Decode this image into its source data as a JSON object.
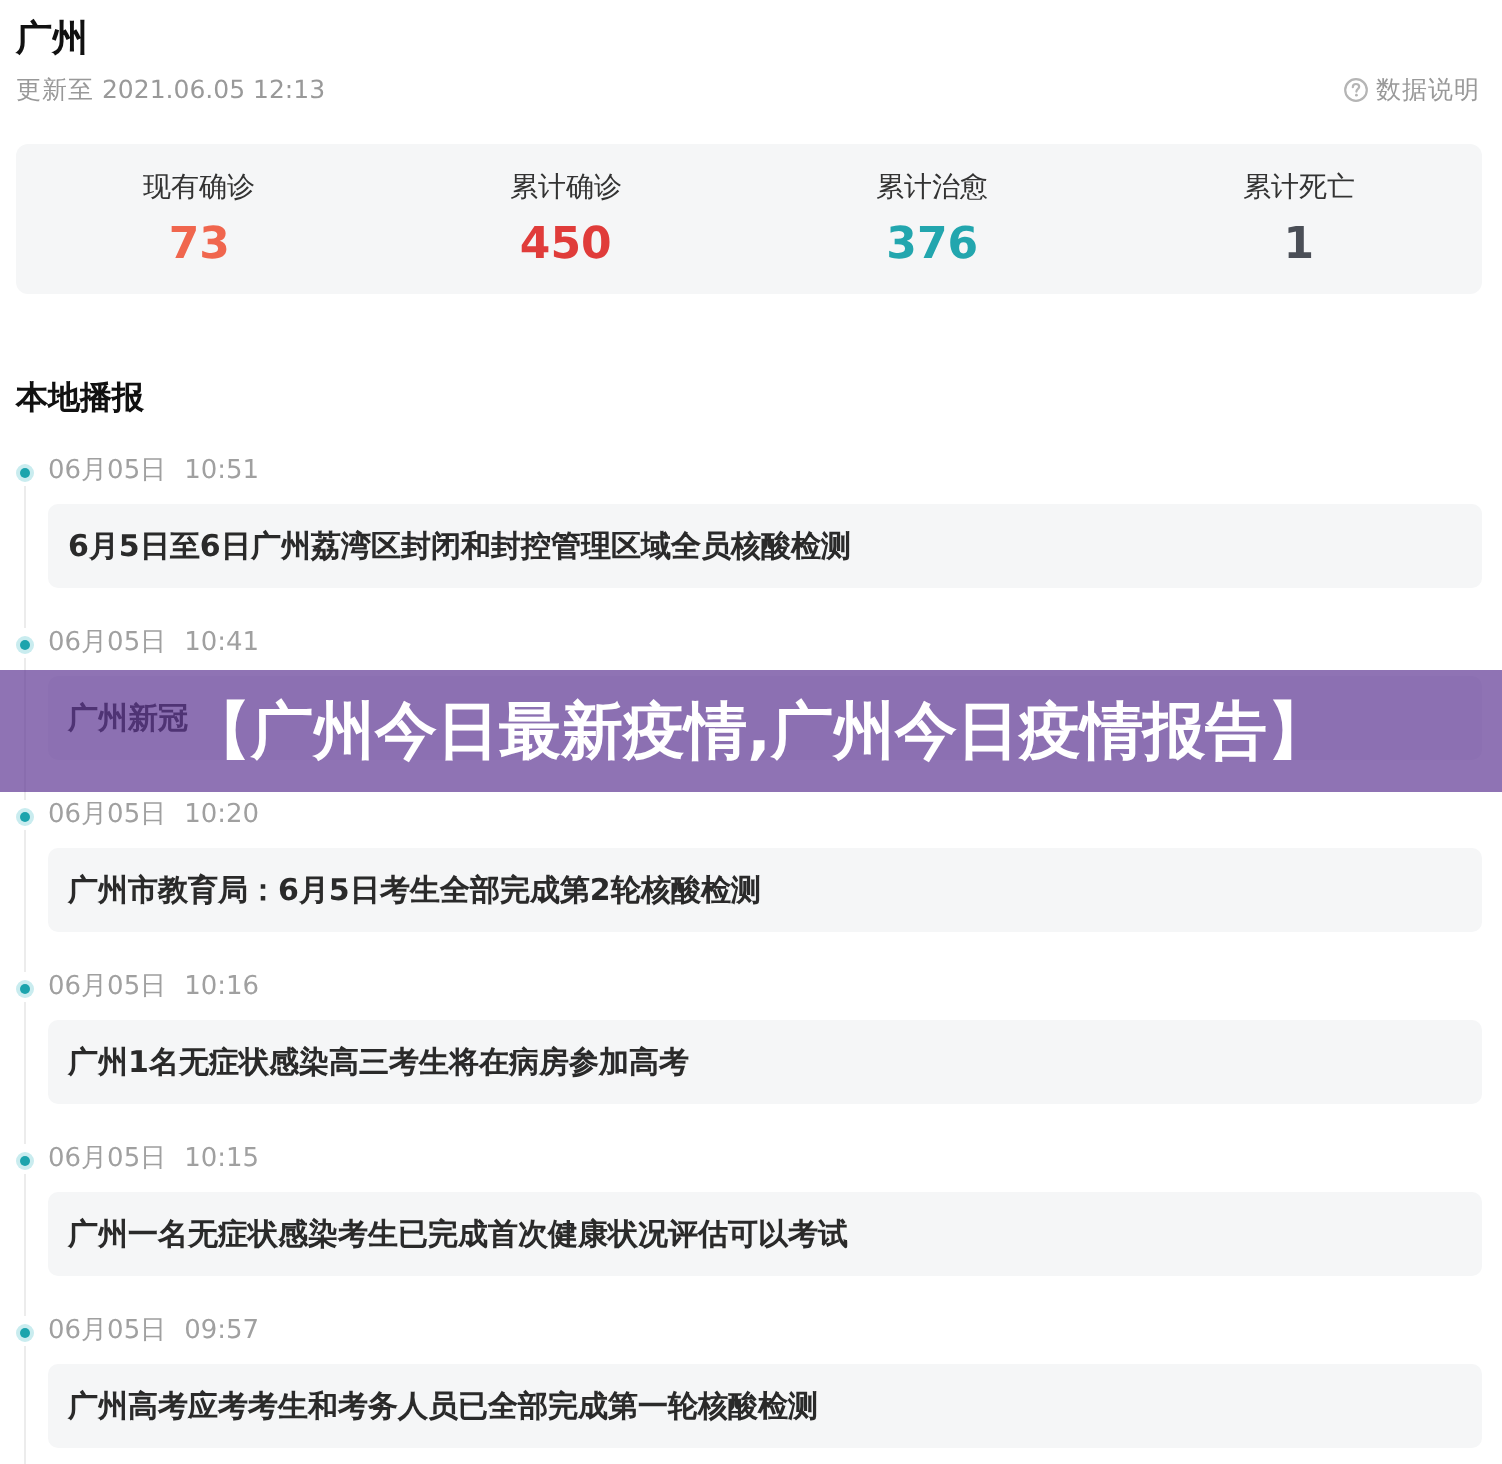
{
  "header": {
    "title": "广州",
    "updated": "更新至 2021.06.05 12:13",
    "data_note": "数据说明"
  },
  "stats": [
    {
      "label": "现有确诊",
      "value": "73",
      "color": "#f0664e"
    },
    {
      "label": "累计确诊",
      "value": "450",
      "color": "#e03c3a"
    },
    {
      "label": "累计治愈",
      "value": "376",
      "color": "#22a6ae"
    },
    {
      "label": "累计死亡",
      "value": "1",
      "color": "#4a4e56"
    }
  ],
  "section_title": "本地播报",
  "news": [
    {
      "date": "06月05日",
      "time": "10:51",
      "headline": "6月5日至6日广州荔湾区封闭和封控管理区域全员核酸检测"
    },
    {
      "date": "06月05日",
      "time": "10:41",
      "headline": "广州新冠"
    },
    {
      "date": "06月05日",
      "time": "10:20",
      "headline": "广州市教育局：6月5日考生全部完成第2轮核酸检测"
    },
    {
      "date": "06月05日",
      "time": "10:16",
      "headline": "广州1名无症状感染高三考生将在病房参加高考"
    },
    {
      "date": "06月05日",
      "time": "10:15",
      "headline": "广州一名无症状感染考生已完成首次健康状况评估可以考试"
    },
    {
      "date": "06月05日",
      "time": "09:57",
      "headline": "广州高考应考考生和考务人员已全部完成第一轮核酸检测"
    }
  ],
  "banner": {
    "text": "【广州今日最新疫情,广州今日疫情报告】"
  }
}
